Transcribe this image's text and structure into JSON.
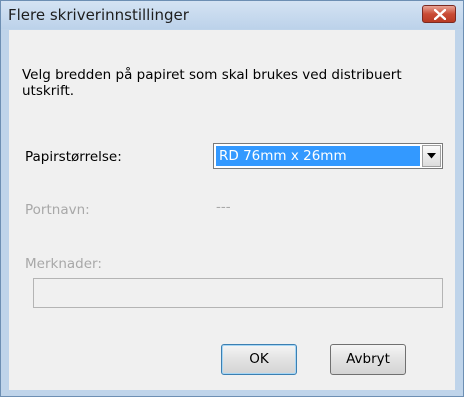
{
  "window": {
    "title": "Flere skriverinnstillinger"
  },
  "dialog": {
    "description": "Velg bredden på papiret som skal brukes ved distribuert utskrift.",
    "paper_size": {
      "label": "Papirstørrelse:",
      "selected_value": "RD 76mm x 26mm"
    },
    "port_name": {
      "label": "Portnavn:",
      "value": "---"
    },
    "notes": {
      "label": "Merknader:",
      "value": ""
    }
  },
  "buttons": {
    "ok_label": "OK",
    "cancel_label": "Avbryt"
  },
  "colors": {
    "selection": "#3399ff",
    "disabled_text": "#a8a8a8",
    "close_button": "#c94b35"
  },
  "icons": {
    "close": "close-icon",
    "dropdown": "chevron-down-icon"
  }
}
